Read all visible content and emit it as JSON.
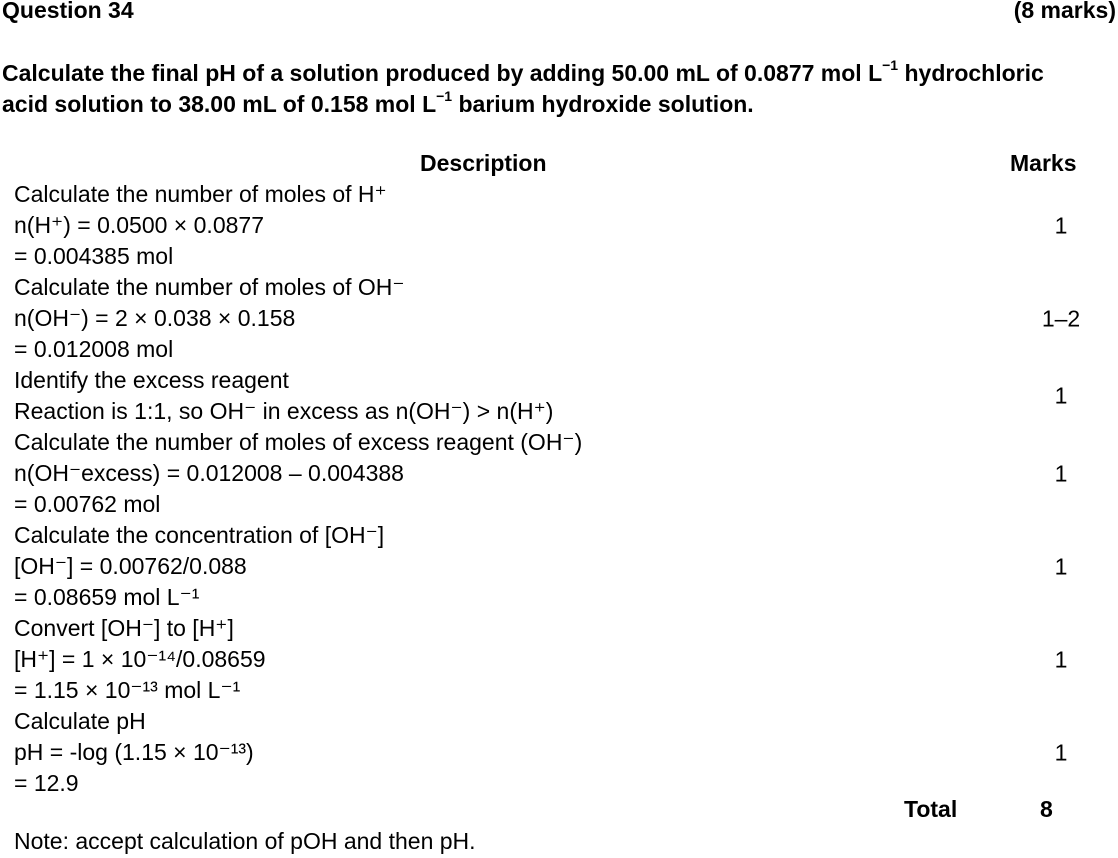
{
  "header": {
    "title": "Question 34",
    "marks": "(8 marks)"
  },
  "question": {
    "line1_a": "Calculate the final pH of a solution produced by adding 50.00 mL of 0.0877 mol L",
    "line1_sup": "−1",
    "line1_b": " hydrochloric",
    "line2_a": "acid solution to 38.00 mL of 0.158 mol L",
    "line2_sup": "−1",
    "line2_b": " barium hydroxide solution."
  },
  "table": {
    "col_description": "Description",
    "col_marks": "Marks",
    "rows": [
      {
        "lines": [
          "Calculate the number of moles of H⁺",
          "n(H⁺) = 0.0500 × 0.0877",
          "= 0.004385 mol"
        ],
        "mark": "1"
      },
      {
        "lines": [
          "Calculate the number of moles of OH⁻",
          "n(OH⁻) = 2 × 0.038 × 0.158",
          "= 0.012008 mol"
        ],
        "mark": "1–2"
      },
      {
        "lines": [
          "Identify the excess reagent",
          "Reaction is 1:1, so OH⁻ in excess as n(OH⁻) > n(H⁺)"
        ],
        "mark": "1"
      },
      {
        "lines": [
          "Calculate the number of moles of excess reagent (OH⁻)",
          "n(OH⁻excess) = 0.012008 – 0.004388",
          "= 0.00762 mol"
        ],
        "mark": "1"
      },
      {
        "lines": [
          "Calculate the concentration of [OH⁻]",
          "[OH⁻] = 0.00762/0.088",
          "= 0.08659 mol L⁻¹"
        ],
        "mark": "1"
      },
      {
        "lines": [
          "Convert [OH⁻] to [H⁺]",
          "[H⁺] = 1 × 10⁻¹⁴/0.08659",
          "= 1.15 × 10⁻¹³ mol L⁻¹"
        ],
        "mark": "1"
      },
      {
        "lines": [
          "Calculate pH",
          "pH  = -log (1.15 × 10⁻¹³)",
          "= 12.9"
        ],
        "mark": "1"
      }
    ],
    "total_label": "Total",
    "total_value": "8"
  },
  "note": "Note: accept calculation of pOH and then pH."
}
